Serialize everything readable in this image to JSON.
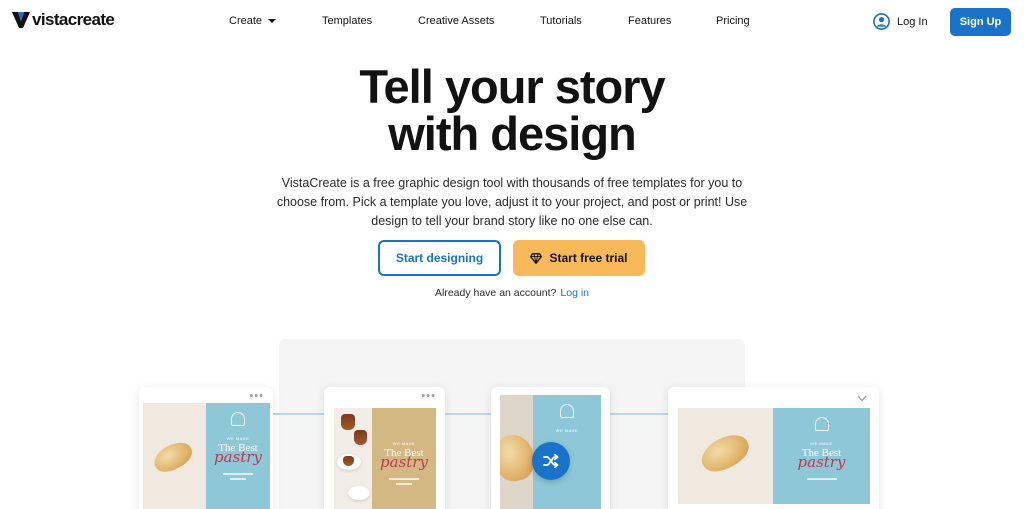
{
  "brand": {
    "name": "vistacreate",
    "accent": "#1a73c8",
    "trial_color": "#f8b95a"
  },
  "nav": {
    "links": [
      "Create",
      "Templates",
      "Creative Assets",
      "Tutorials",
      "Features",
      "Pricing"
    ],
    "login": "Log In",
    "signup": "Sign Up",
    "icons": {
      "create_dropdown": "caret-down-icon",
      "login": "user-circle-icon"
    }
  },
  "hero": {
    "headline_line1": "Tell your story",
    "headline_line2": "with design",
    "subtitle": "VistaCreate is a free graphic design tool with thousands of free templates for you to choose from. Pick a template you love, adjust it to your project, and post or print! Use design to tell your brand story like no one else can.",
    "cta_primary": "Start designing",
    "cta_trial": "Start free trial",
    "already_text": "Already have an account?",
    "already_link": "Log in"
  },
  "showcase": {
    "template_headline": "The Best",
    "template_script": "pastry",
    "template_eyebrow": "WE MAKE",
    "card_menu": "•••",
    "icons": {
      "shuffle": "shuffle-icon",
      "expand": "chevron-down-icon",
      "trial": "gem-icon"
    }
  }
}
